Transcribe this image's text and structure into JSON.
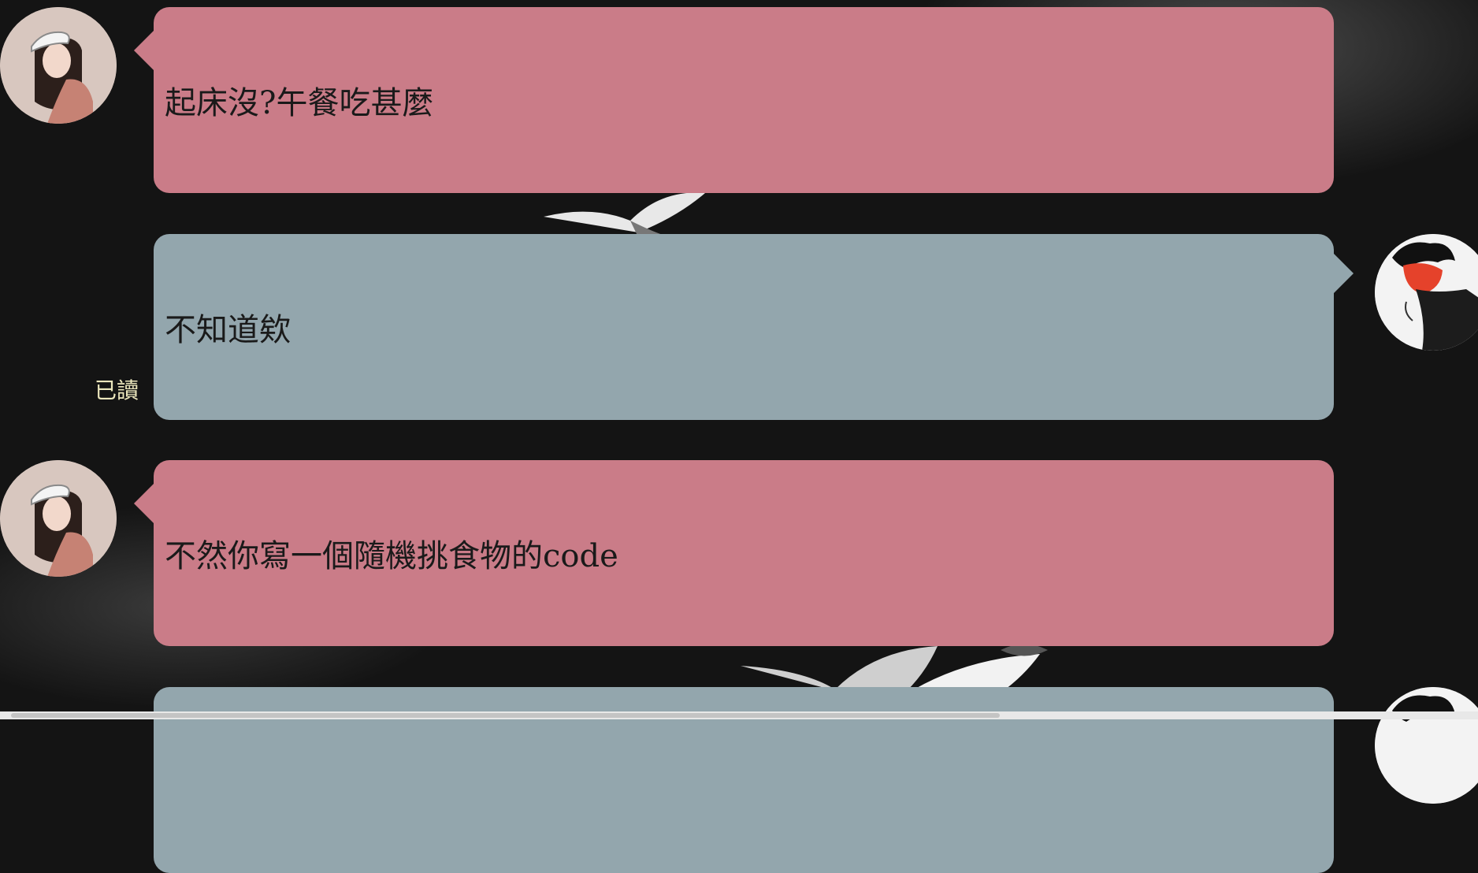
{
  "messages": [
    {
      "side": "left",
      "sender": "girl",
      "text": "起床沒?午餐吃甚麼"
    },
    {
      "side": "right",
      "sender": "boy",
      "text": "不知道欸",
      "status": "已讀"
    },
    {
      "side": "left",
      "sender": "girl",
      "text": "不然你寫一個隨機挑食物的code"
    },
    {
      "side": "right",
      "sender": "boy",
      "text": ""
    }
  ],
  "colors": {
    "background": "#141414",
    "bubble_left": "#ca7c88",
    "bubble_right": "#93a6ad",
    "read_status": "#ece7bd"
  },
  "icons": {
    "left_avatar": "girl-avatar-icon",
    "right_avatar": "boy-avatar-icon"
  }
}
